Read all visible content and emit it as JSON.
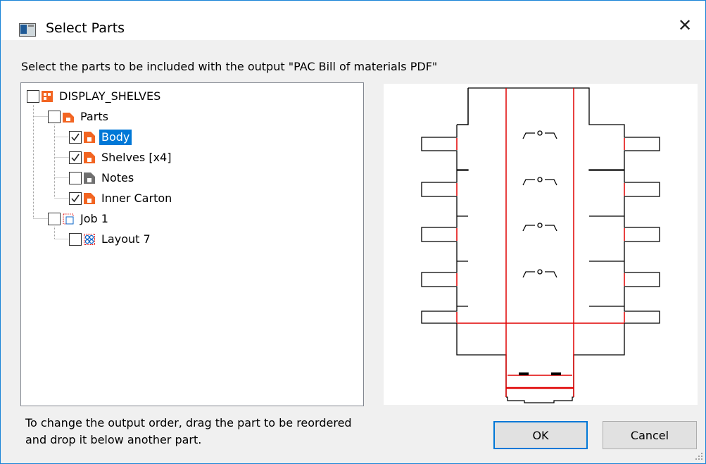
{
  "window": {
    "title": "Select Parts",
    "close_glyph": "✕"
  },
  "instruction": "Select the parts to be included with the output \"PAC Bill of materials PDF\"",
  "tree": {
    "root": {
      "label": "DISPLAY_SHELVES",
      "checked": false,
      "icon": "assembly-icon"
    },
    "parts_folder": {
      "label": "Parts",
      "checked": false,
      "icon": "parts-folder-icon"
    },
    "parts": [
      {
        "label": "Body",
        "checked": true,
        "selected": true,
        "icon": "part-icon"
      },
      {
        "label": "Shelves [x4]",
        "checked": true,
        "selected": false,
        "icon": "part-icon"
      },
      {
        "label": "Notes",
        "checked": false,
        "selected": false,
        "icon": "notes-icon"
      },
      {
        "label": "Inner Carton",
        "checked": true,
        "selected": false,
        "icon": "part-icon"
      }
    ],
    "job": {
      "label": "Job 1",
      "checked": false,
      "icon": "job-icon"
    },
    "layout": {
      "label": "Layout 7",
      "checked": false,
      "icon": "layout-icon"
    }
  },
  "hint": "To change the output order, drag the part to be reordered and drop it below another part.",
  "buttons": {
    "ok": "OK",
    "cancel": "Cancel"
  },
  "colors": {
    "part_orange": "#f26522",
    "selection": "#0078d7",
    "cut_line": "#000000",
    "crease_line": "#e00000",
    "notes_gray": "#707070"
  }
}
